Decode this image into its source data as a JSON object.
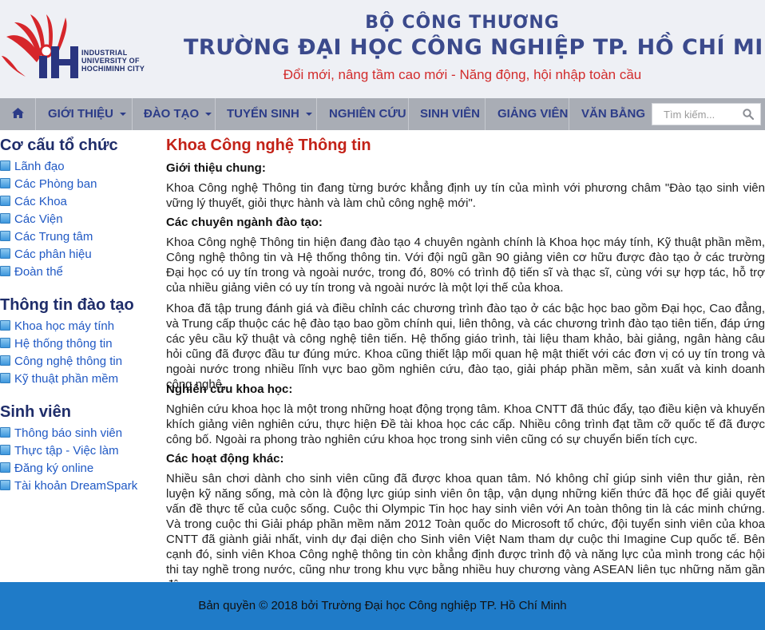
{
  "header": {
    "logo_text_lines": [
      "INDUSTRIAL",
      "UNIVERSITY OF",
      "HOCHIMINH CITY"
    ],
    "ministry": "BỘ CÔNG THƯƠNG",
    "university": "TRƯỜNG ĐẠI HỌC CÔNG NGHIỆP TP. HỒ CHÍ MINH",
    "slogan": "Đổi mới, nâng tầm cao mới - Năng động, hội nhập toàn cầu"
  },
  "nav": {
    "home_icon": "home-icon",
    "items": [
      {
        "label": "GIỚI THIỆU",
        "dropdown": true
      },
      {
        "label": "ĐÀO TẠO",
        "dropdown": true
      },
      {
        "label": "TUYỂN SINH",
        "dropdown": true
      },
      {
        "label": "NGHIÊN CỨU",
        "dropdown": false
      },
      {
        "label": "SINH VIÊN",
        "dropdown": false
      },
      {
        "label": "GIẢNG VIÊN",
        "dropdown": false
      },
      {
        "label": "VĂN BẰNG",
        "dropdown": false
      }
    ],
    "search_placeholder": "Tìm kiếm...",
    "search_icon": "search-icon"
  },
  "sidebar": {
    "sections": [
      {
        "title": "Cơ cấu tổ chức",
        "links": [
          "Lãnh đạo",
          "Các Phòng ban",
          "Các Khoa",
          "Các Viện",
          "Các Trung tâm",
          "Các phân hiệu",
          "Đoàn thể"
        ]
      },
      {
        "title": "Thông tin đào tạo",
        "links": [
          "Khoa học máy tính",
          "Hệ thống thông tin",
          "Công nghệ thông tin",
          "Kỹ thuật phần mềm"
        ]
      },
      {
        "title": "Sinh viên",
        "links": [
          "Thông báo sinh viên",
          "Thực tập - Việc làm",
          "Đăng ký online",
          "Tài khoản DreamSpark"
        ]
      }
    ]
  },
  "main": {
    "title": "Khoa Công nghệ Thông tin",
    "sections": [
      {
        "heading": "Giới thiệu chung:",
        "paragraphs": [
          "Khoa Công nghệ Thông tin đang từng bước khẳng định uy tín của mình với phương châm \"Đào tạo sinh viên vững lý thuyết, giỏi thực hành và làm chủ công nghệ mới\"."
        ]
      },
      {
        "heading": "Các chuyên ngành đào tạo:",
        "paragraphs": [
          "Khoa Công nghệ Thông tin hiện đang đào tạo 4 chuyên ngành chính là Khoa học máy tính, Kỹ thuật phần mềm, Công nghệ thông tin và Hệ thống thông tin. Với đội ngũ gần 90 giảng viên cơ hữu được đào tạo ở các trường Đại học có uy tín trong và ngoài nước, trong đó, 80% có trình độ tiến sĩ và thạc sĩ, cùng với sự hợp tác, hỗ trợ của nhiều giảng viên có uy tín trong và ngoài nước là một lợi thế của khoa.",
          "Khoa đã tập trung đánh giá và điều chỉnh các chương trình đào tạo ở các bậc học bao gồm Đại học, Cao đẳng, và Trung cấp thuộc các hệ đào tạo bao gồm chính qui, liên thông, và các chương trình đào tạo tiên tiến, đáp ứng các yêu cầu kỹ thuật và công nghệ tiên tiến. Hệ thống giáo trình, tài liệu tham khảo, bài giảng, ngân hàng câu hỏi cũng đã được đầu tư đúng mức. Khoa cũng thiết lập mối quan hệ mật thiết với các đơn vị có uy tín trong và ngoài nước trong nhiều lĩnh vực bao gồm nghiên cứu, đào tạo, giải pháp phần mềm, sản xuất và kinh doanh công nghệ."
        ]
      },
      {
        "heading": "Nghiên cứu khoa học:",
        "paragraphs": [
          "Nghiên cứu khoa học là một trong những hoạt động trọng tâm. Khoa CNTT đã thúc đẩy, tạo điều kiện và khuyến khích giảng viên nghiên cứu, thực hiện Đề tài khoa học các cấp. Nhiều công trình đạt tầm cỡ quốc tế đã được công bố. Ngoài ra phong trào nghiên cứu khoa học trong sinh viên cũng có sự chuyển biến tích cực."
        ]
      },
      {
        "heading": "Các hoạt động khác:",
        "paragraphs": [
          "Nhiều sân chơi dành cho sinh viên cũng đã được khoa quan tâm. Nó không chỉ giúp sinh viên thư giản, rèn luyện kỹ năng sống, mà còn là động lực giúp sinh viên ôn tập, vận dụng những kiến thức đã học để giải quyết vấn đề thực tế của cuộc sống. Cuộc thi Olympic Tin học hay sinh viên với An toàn thông tin là các minh chứng. Và trong cuộc thi Giải pháp phần mềm năm 2012 Toàn quốc do Microsoft tổ chức, đội tuyển sinh viên của khoa CNTT đã giành giải nhất, vinh dự đại diện cho Sinh viên Việt Nam tham dự cuộc thi Imagine Cup quốc tế. Bên cạnh đó, sinh viên Khoa Công nghệ thông tin còn khẳng định được trình độ và năng lực của mình trong các hội thi tay nghề trong nước, cũng như trong khu vực bằng nhiều huy chương vàng ASEAN liên tục những năm gần đây."
        ]
      }
    ]
  },
  "footer": {
    "copyright": "Bản quyền © 2018 bởi Trường Đại học Công nghiệp TP. Hồ Chí Minh"
  },
  "colors": {
    "nav_bg": "#a9adb5",
    "nav_text": "#2c3c88",
    "title_red": "#c32218",
    "link_blue": "#2059c4",
    "footer_bg": "#1f7bc8"
  }
}
